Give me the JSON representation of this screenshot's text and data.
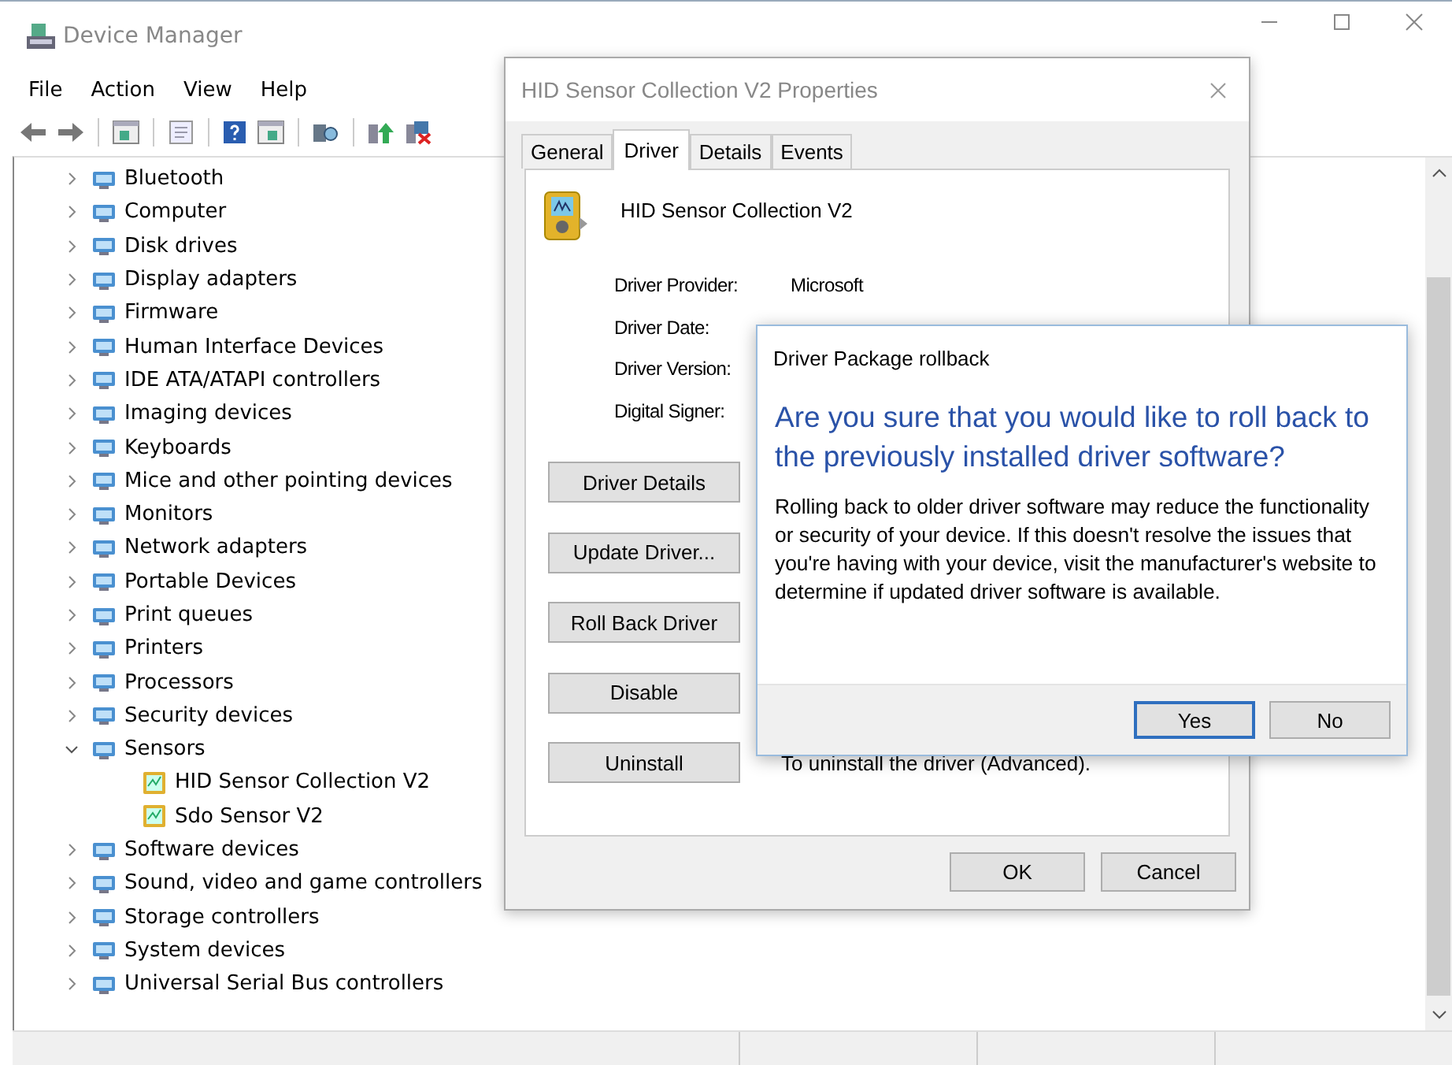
{
  "window": {
    "title": "Device Manager"
  },
  "menu": [
    "File",
    "Action",
    "View",
    "Help"
  ],
  "tree": [
    {
      "label": "Bluetooth",
      "expanded": false
    },
    {
      "label": "Computer",
      "expanded": false
    },
    {
      "label": "Disk drives",
      "expanded": false
    },
    {
      "label": "Display adapters",
      "expanded": false
    },
    {
      "label": "Firmware",
      "expanded": false
    },
    {
      "label": "Human Interface Devices",
      "expanded": false
    },
    {
      "label": "IDE ATA/ATAPI controllers",
      "expanded": false
    },
    {
      "label": "Imaging devices",
      "expanded": false
    },
    {
      "label": "Keyboards",
      "expanded": false
    },
    {
      "label": "Mice and other pointing devices",
      "expanded": false
    },
    {
      "label": "Monitors",
      "expanded": false
    },
    {
      "label": "Network adapters",
      "expanded": false
    },
    {
      "label": "Portable Devices",
      "expanded": false
    },
    {
      "label": "Print queues",
      "expanded": false
    },
    {
      "label": "Printers",
      "expanded": false
    },
    {
      "label": "Processors",
      "expanded": false
    },
    {
      "label": "Security devices",
      "expanded": false
    },
    {
      "label": "Sensors",
      "expanded": true,
      "children": [
        {
          "label": "HID Sensor Collection V2"
        },
        {
          "label": "Sdo Sensor V2"
        }
      ]
    },
    {
      "label": "Software devices",
      "expanded": false
    },
    {
      "label": "Sound, video and game controllers",
      "expanded": false
    },
    {
      "label": "Storage controllers",
      "expanded": false
    },
    {
      "label": "System devices",
      "expanded": false
    },
    {
      "label": "Universal Serial Bus controllers",
      "expanded": false
    }
  ],
  "properties": {
    "title": "HID Sensor Collection V2 Properties",
    "tabs": [
      {
        "label": "General",
        "selected": false
      },
      {
        "label": "Driver",
        "selected": true
      },
      {
        "label": "Details",
        "selected": false
      },
      {
        "label": "Events",
        "selected": false
      }
    ],
    "device_name": "HID Sensor Collection V2",
    "fields": [
      {
        "label": "Driver Provider:",
        "value": "Microsoft"
      },
      {
        "label": "Driver Date:"
      },
      {
        "label": "Driver Version:"
      },
      {
        "label": "Digital Signer:"
      }
    ],
    "actions": [
      {
        "button": "Driver Details"
      },
      {
        "button": "Update Driver..."
      },
      {
        "button": "Roll Back Driver"
      },
      {
        "button": "Disable"
      },
      {
        "button": "Uninstall",
        "description": "To uninstall the driver (Advanced)."
      }
    ],
    "buttons": [
      "OK",
      "Cancel"
    ]
  },
  "rollback_dialog": {
    "title": "Driver Package rollback",
    "heading": "Are you sure that you would like to roll back to the previously installed driver software?",
    "message": "Rolling back to older driver software may reduce the functionality or security of your device. If this doesn't resolve the issues that you're having with your device, visit the manufacturer's website to determine if updated driver software is available.",
    "buttons": [
      {
        "label": "Yes",
        "selected": true
      },
      {
        "label": "No",
        "selected": false
      }
    ]
  }
}
